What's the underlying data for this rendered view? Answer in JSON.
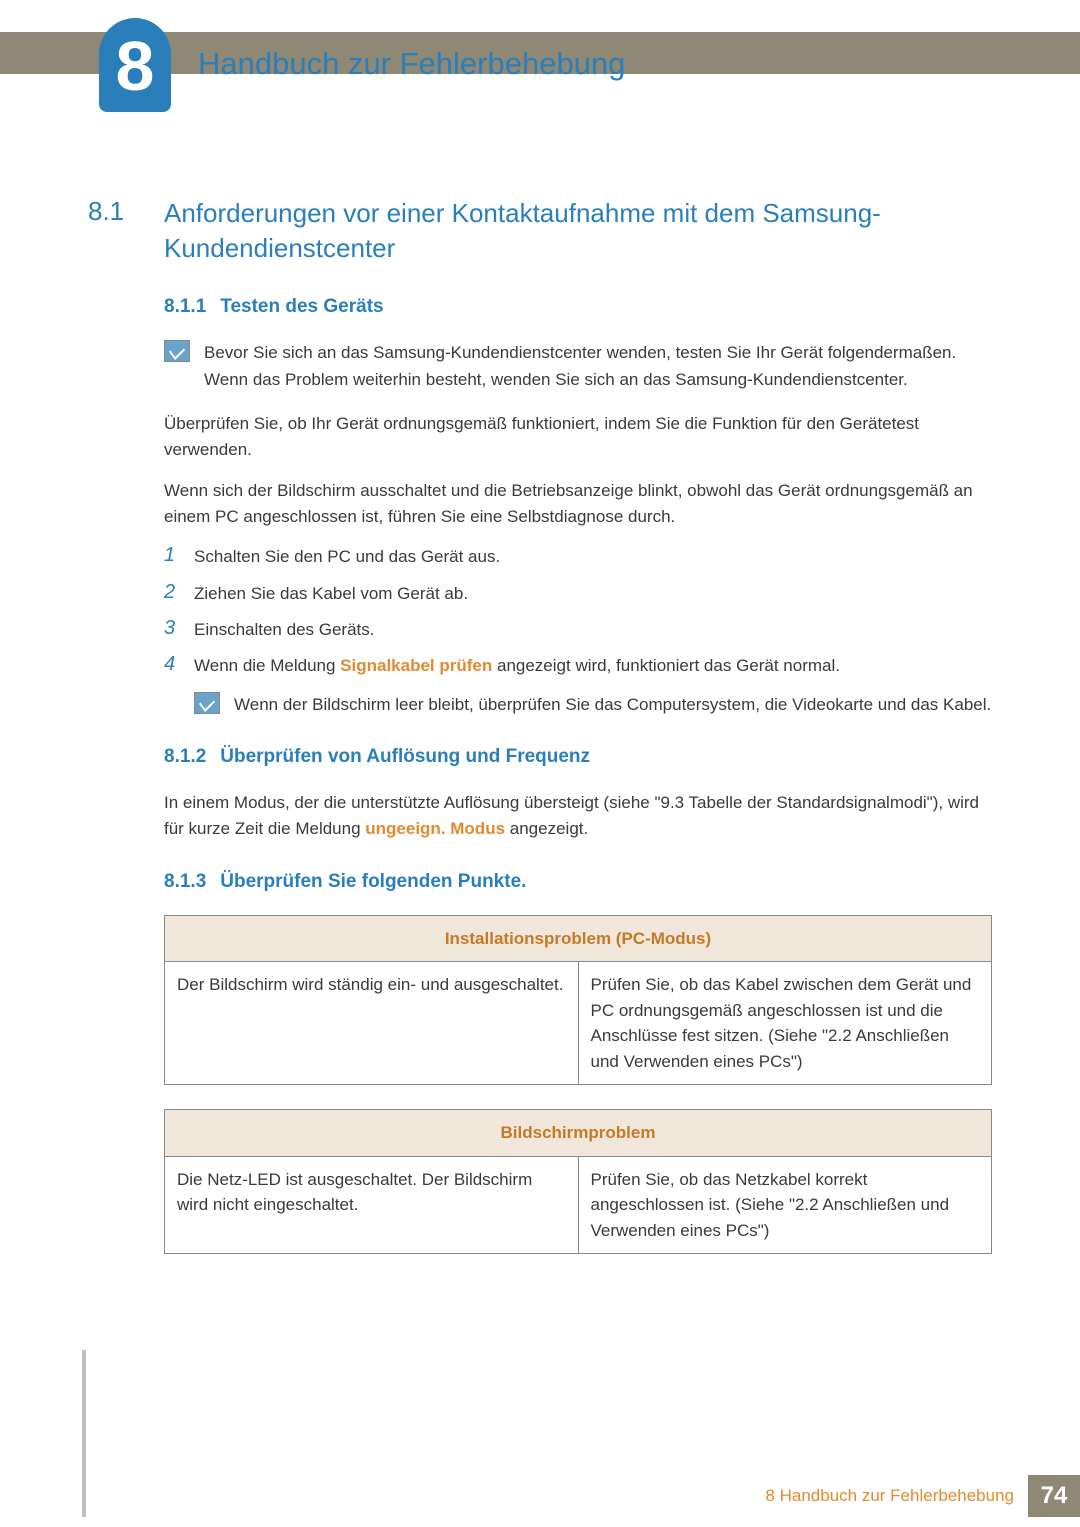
{
  "chapter": {
    "number": "8",
    "title": "Handbuch zur Fehlerbehebung"
  },
  "section": {
    "num": "8.1",
    "title": "Anforderungen vor einer Kontaktaufnahme mit dem Samsung-Kundendienstcenter"
  },
  "sub1": {
    "num": "8.1.1",
    "title": "Testen des Geräts",
    "note": "Bevor Sie sich an das Samsung-Kundendienstcenter wenden, testen Sie Ihr Gerät folgendermaßen. Wenn das Problem weiterhin besteht, wenden Sie sich an das Samsung-Kundendienstcenter.",
    "p1": "Überprüfen Sie, ob Ihr Gerät ordnungsgemäß funktioniert, indem Sie die Funktion für den Gerätetest verwenden.",
    "p2": "Wenn sich der Bildschirm ausschaltet und die Betriebsanzeige blinkt, obwohl das Gerät ordnungsgemäß an einem PC angeschlossen ist, führen Sie eine Selbstdiagnose durch.",
    "steps": {
      "1": "Schalten Sie den PC und das Gerät aus.",
      "2": "Ziehen Sie das Kabel vom Gerät ab.",
      "3": "Einschalten des Geräts.",
      "4a": "Wenn die Meldung ",
      "4b": "Signalkabel prüfen",
      "4c": " angezeigt wird, funktioniert das Gerät normal."
    },
    "nestedNote": "Wenn der Bildschirm leer bleibt, überprüfen Sie das Computersystem, die Videokarte und das Kabel."
  },
  "sub2": {
    "num": "8.1.2",
    "title": "Überprüfen von Auflösung und Frequenz",
    "p_a": "In einem Modus, der die unterstützte Auflösung übersteigt (siehe \"9.3 Tabelle der Standardsignalmodi\"), wird für kurze Zeit die Meldung ",
    "p_b": "ungeeign. Modus",
    "p_c": " angezeigt."
  },
  "sub3": {
    "num": "8.1.3",
    "title": "Überprüfen Sie folgenden Punkte."
  },
  "table1": {
    "header": "Installationsproblem (PC-Modus)",
    "r1c1": "Der Bildschirm wird ständig ein- und ausgeschaltet.",
    "r1c2": "Prüfen Sie, ob das Kabel zwischen dem Gerät und PC ordnungsgemäß angeschlossen ist und die Anschlüsse fest sitzen. (Siehe \"2.2 Anschließen und Verwenden eines PCs\")"
  },
  "table2": {
    "header": "Bildschirmproblem",
    "r1c1": "Die Netz-LED ist ausgeschaltet. Der Bildschirm wird nicht eingeschaltet.",
    "r1c2": "Prüfen Sie, ob das Netzkabel korrekt angeschlossen ist. (Siehe \"2.2 Anschließen und Verwenden eines PCs\")"
  },
  "footer": {
    "title": "8 Handbuch zur Fehlerbehebung",
    "page": "74"
  }
}
